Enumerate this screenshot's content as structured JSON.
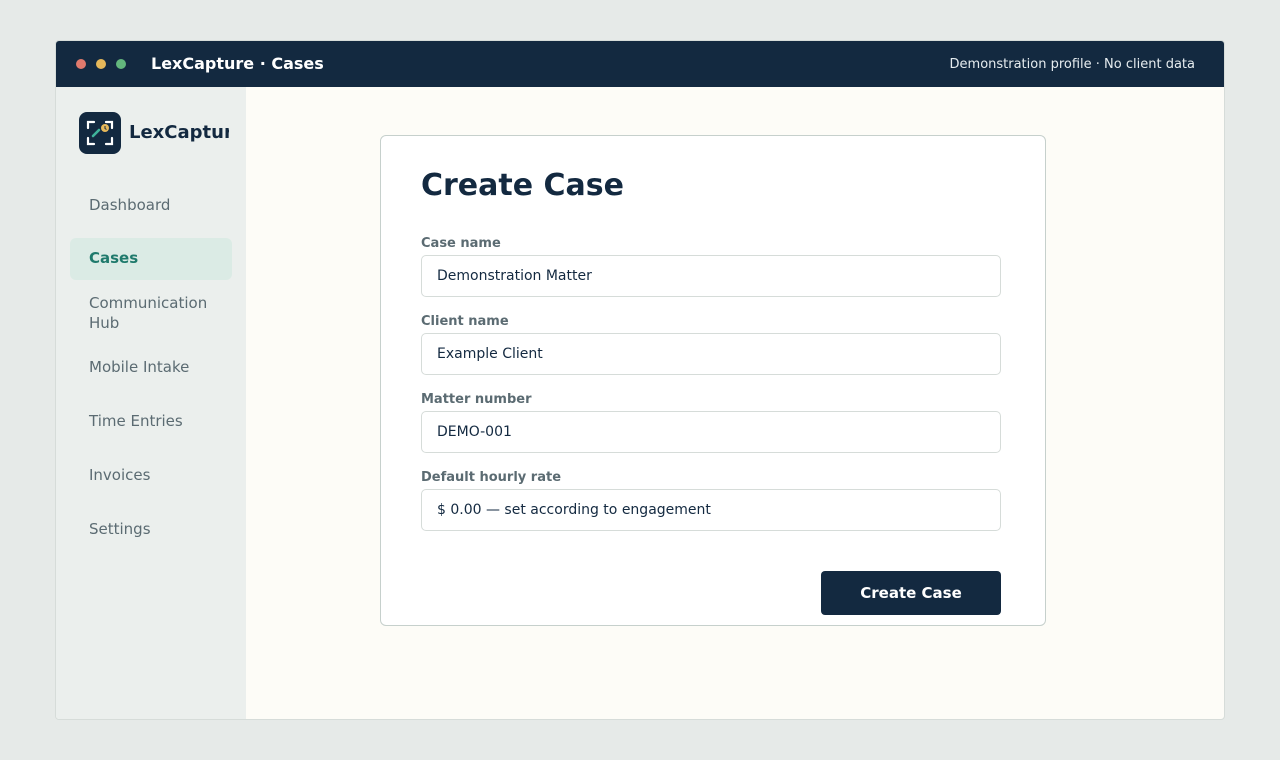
{
  "window": {
    "title": "LexCapture · Cases",
    "profile_notice": "Demonstration profile · No client data"
  },
  "sidebar": {
    "logo_text": "LexCapture",
    "logo_icon": "capture-frame-icon",
    "items": [
      {
        "label": "Dashboard",
        "active": false
      },
      {
        "label": "Cases",
        "active": true
      },
      {
        "label": "Communication Hub",
        "active": false
      },
      {
        "label": "Mobile Intake",
        "active": false
      },
      {
        "label": "Time Entries",
        "active": false
      },
      {
        "label": "Invoices",
        "active": false
      },
      {
        "label": "Settings",
        "active": false
      }
    ]
  },
  "form": {
    "title": "Create Case",
    "fields": [
      {
        "label": "Case name",
        "value": "Demonstration Matter"
      },
      {
        "label": "Client name",
        "value": "Example Client"
      },
      {
        "label": "Matter number",
        "value": "DEMO-001"
      },
      {
        "label": "Default hourly rate",
        "value": "$ 0.00 — set according to engagement"
      }
    ],
    "submit_label": "Create Case"
  },
  "colors": {
    "navy": "#132940",
    "accent_teal": "#1f7a6c",
    "active_bg": "#dbebe5",
    "sidebar_bg": "#ebefed",
    "content_bg": "#fdfcf7"
  }
}
